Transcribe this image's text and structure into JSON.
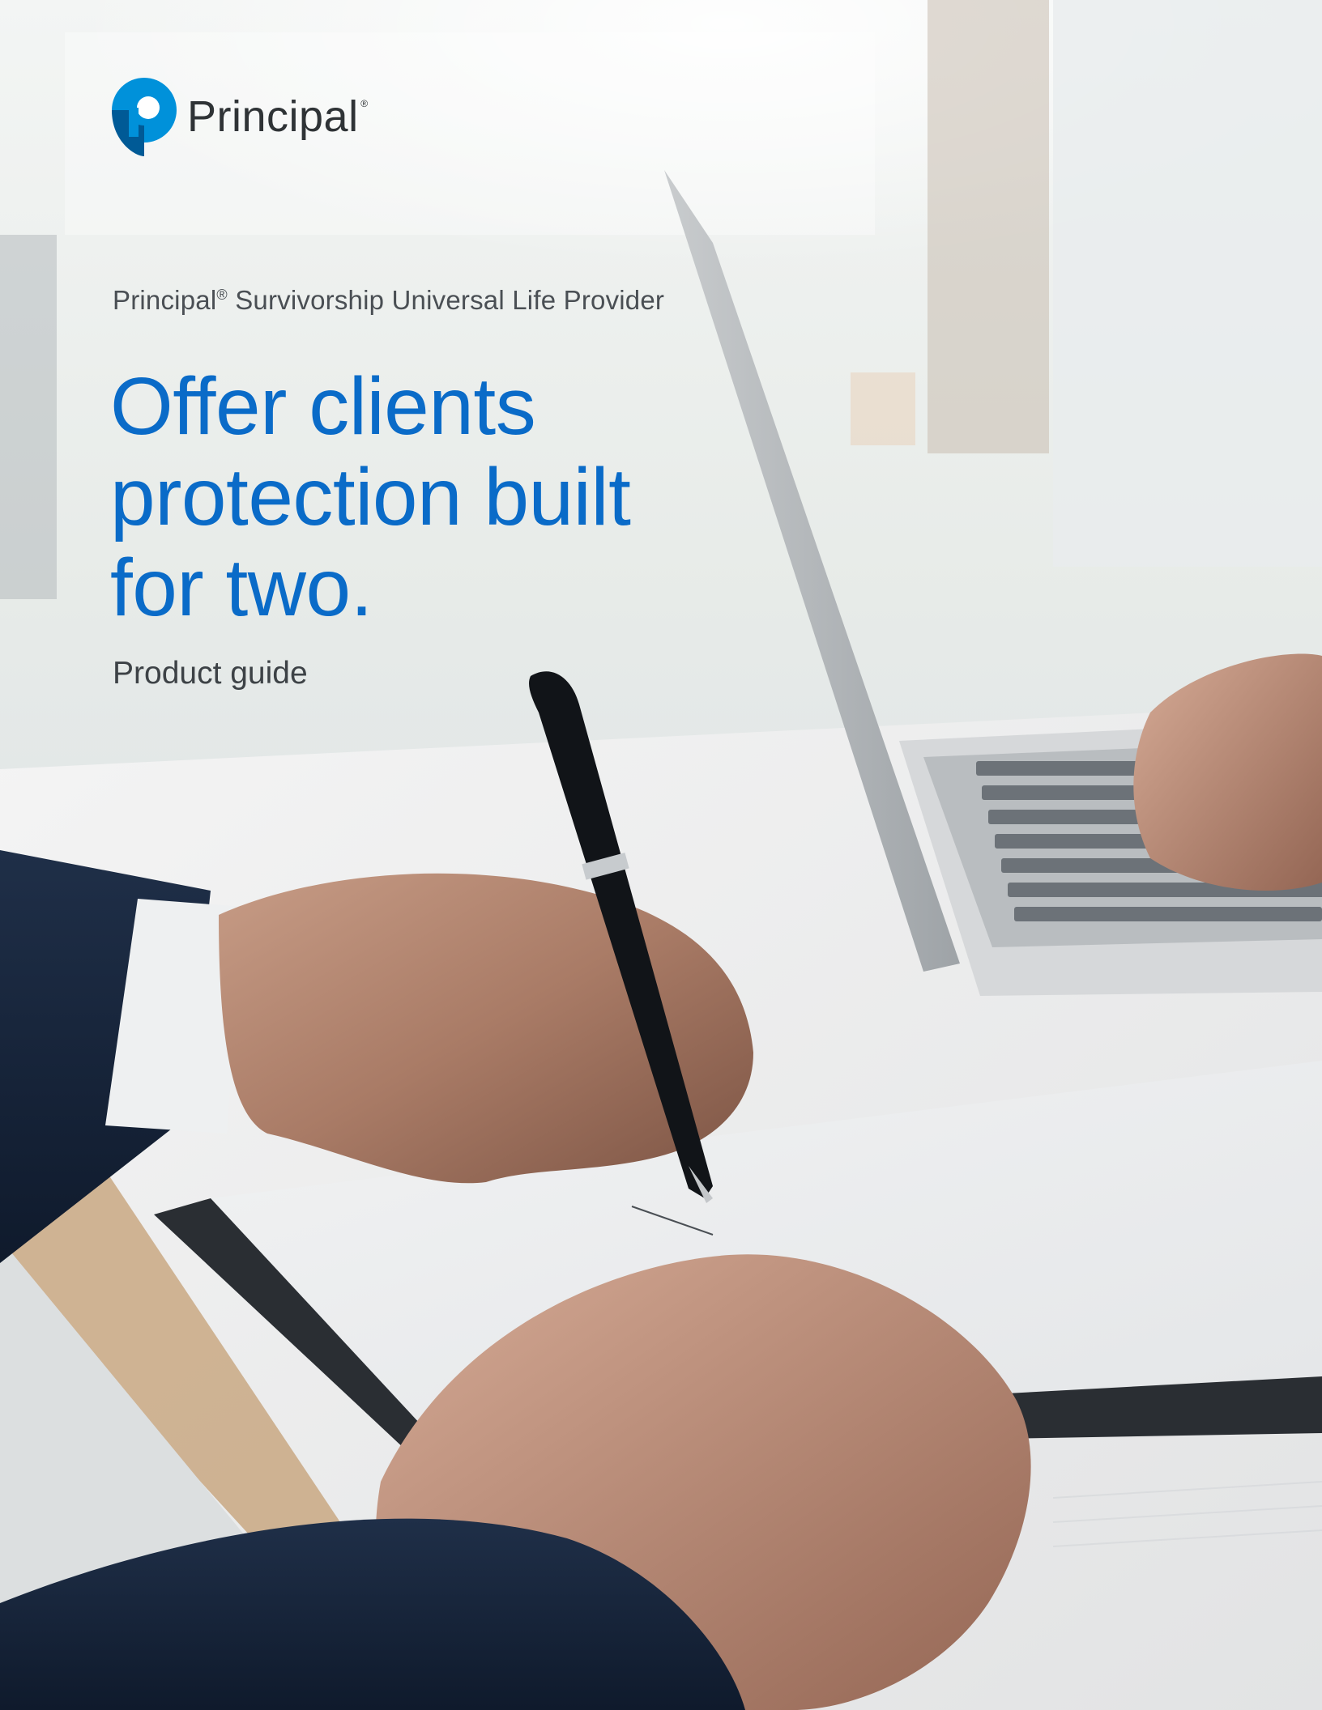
{
  "brand": {
    "name": "Principal",
    "trademark": "®",
    "colors": {
      "primary_blue": "#0a6bc8",
      "logo_blue": "#0091da",
      "logo_dark_blue": "#005a96",
      "text_dark": "#3d4246"
    }
  },
  "cover": {
    "eyebrow_brand": "Principal",
    "eyebrow_mark": "®",
    "eyebrow_rest": " Survivorship Universal Life Provider",
    "headline_lines": [
      "Offer clients",
      "protection built",
      "for two."
    ],
    "subtitle": "Product guide"
  },
  "image": {
    "icon": "photo-business-signing-icon"
  }
}
